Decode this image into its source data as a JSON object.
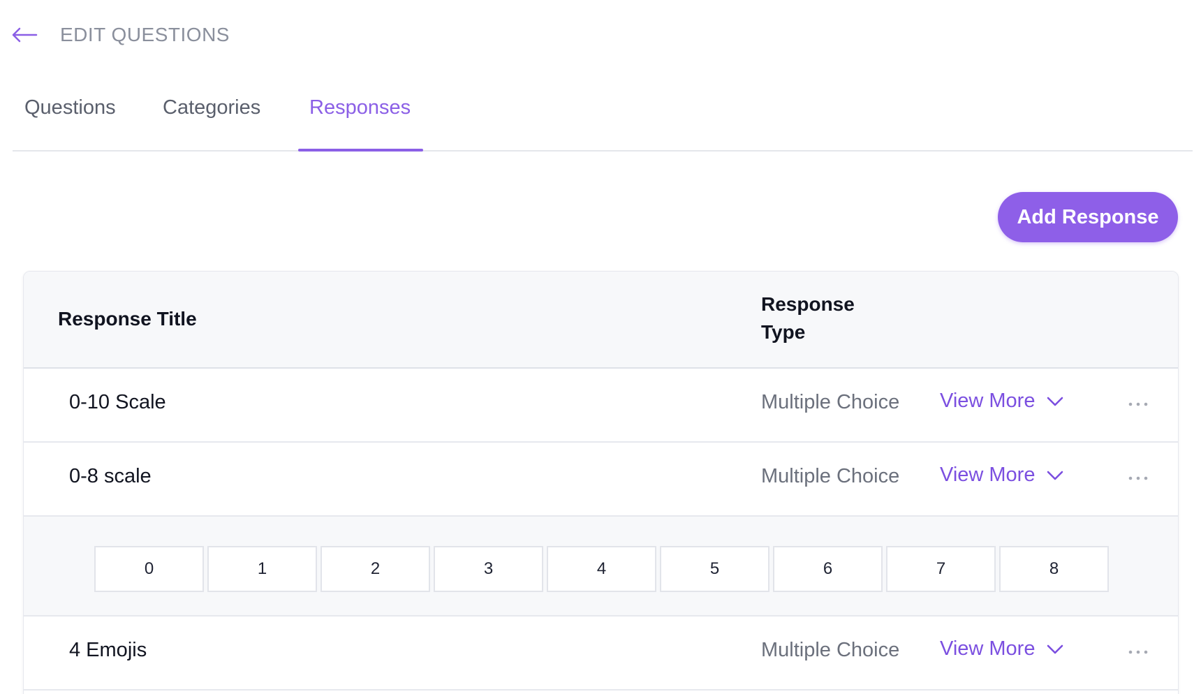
{
  "header": {
    "title": "EDIT QUESTIONS",
    "back_icon": "arrow-left-icon"
  },
  "tabs": [
    {
      "label": "Questions",
      "active": false
    },
    {
      "label": "Categories",
      "active": false
    },
    {
      "label": "Responses",
      "active": true
    }
  ],
  "actions": {
    "add_response_label": "Add Response"
  },
  "table": {
    "headers": {
      "title": "Response Title",
      "type": "Response Type"
    },
    "rows": [
      {
        "title": "0-10 Scale",
        "type": "Multiple Choice",
        "view_more": "View More"
      },
      {
        "title": "0-8 scale",
        "type": "Multiple Choice",
        "view_more": "View More"
      },
      {
        "title": "4 Emojis",
        "type": "Multiple Choice",
        "view_more": "View More"
      }
    ],
    "expanded_options": [
      "0",
      "1",
      "2",
      "3",
      "4",
      "5",
      "6",
      "7",
      "8"
    ]
  },
  "colors": {
    "accent": "#8b5fe6",
    "button": "#8e5fe8",
    "header_text": "#8a8f9c"
  }
}
